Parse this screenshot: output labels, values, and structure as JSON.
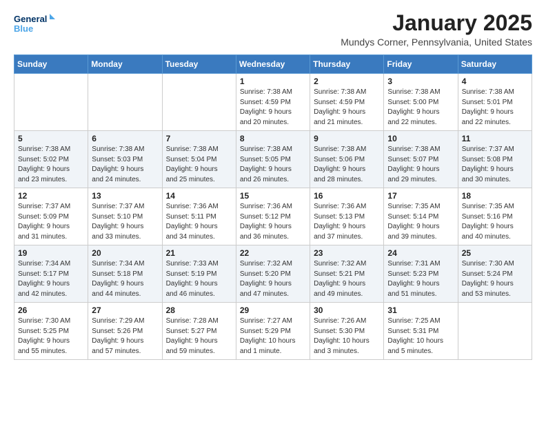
{
  "header": {
    "logo_line1": "General",
    "logo_line2": "Blue",
    "month": "January 2025",
    "location": "Mundys Corner, Pennsylvania, United States"
  },
  "weekdays": [
    "Sunday",
    "Monday",
    "Tuesday",
    "Wednesday",
    "Thursday",
    "Friday",
    "Saturday"
  ],
  "weeks": [
    [
      {
        "day": "",
        "info": ""
      },
      {
        "day": "",
        "info": ""
      },
      {
        "day": "",
        "info": ""
      },
      {
        "day": "1",
        "info": "Sunrise: 7:38 AM\nSunset: 4:59 PM\nDaylight: 9 hours\nand 20 minutes."
      },
      {
        "day": "2",
        "info": "Sunrise: 7:38 AM\nSunset: 4:59 PM\nDaylight: 9 hours\nand 21 minutes."
      },
      {
        "day": "3",
        "info": "Sunrise: 7:38 AM\nSunset: 5:00 PM\nDaylight: 9 hours\nand 22 minutes."
      },
      {
        "day": "4",
        "info": "Sunrise: 7:38 AM\nSunset: 5:01 PM\nDaylight: 9 hours\nand 22 minutes."
      }
    ],
    [
      {
        "day": "5",
        "info": "Sunrise: 7:38 AM\nSunset: 5:02 PM\nDaylight: 9 hours\nand 23 minutes."
      },
      {
        "day": "6",
        "info": "Sunrise: 7:38 AM\nSunset: 5:03 PM\nDaylight: 9 hours\nand 24 minutes."
      },
      {
        "day": "7",
        "info": "Sunrise: 7:38 AM\nSunset: 5:04 PM\nDaylight: 9 hours\nand 25 minutes."
      },
      {
        "day": "8",
        "info": "Sunrise: 7:38 AM\nSunset: 5:05 PM\nDaylight: 9 hours\nand 26 minutes."
      },
      {
        "day": "9",
        "info": "Sunrise: 7:38 AM\nSunset: 5:06 PM\nDaylight: 9 hours\nand 28 minutes."
      },
      {
        "day": "10",
        "info": "Sunrise: 7:38 AM\nSunset: 5:07 PM\nDaylight: 9 hours\nand 29 minutes."
      },
      {
        "day": "11",
        "info": "Sunrise: 7:37 AM\nSunset: 5:08 PM\nDaylight: 9 hours\nand 30 minutes."
      }
    ],
    [
      {
        "day": "12",
        "info": "Sunrise: 7:37 AM\nSunset: 5:09 PM\nDaylight: 9 hours\nand 31 minutes."
      },
      {
        "day": "13",
        "info": "Sunrise: 7:37 AM\nSunset: 5:10 PM\nDaylight: 9 hours\nand 33 minutes."
      },
      {
        "day": "14",
        "info": "Sunrise: 7:36 AM\nSunset: 5:11 PM\nDaylight: 9 hours\nand 34 minutes."
      },
      {
        "day": "15",
        "info": "Sunrise: 7:36 AM\nSunset: 5:12 PM\nDaylight: 9 hours\nand 36 minutes."
      },
      {
        "day": "16",
        "info": "Sunrise: 7:36 AM\nSunset: 5:13 PM\nDaylight: 9 hours\nand 37 minutes."
      },
      {
        "day": "17",
        "info": "Sunrise: 7:35 AM\nSunset: 5:14 PM\nDaylight: 9 hours\nand 39 minutes."
      },
      {
        "day": "18",
        "info": "Sunrise: 7:35 AM\nSunset: 5:16 PM\nDaylight: 9 hours\nand 40 minutes."
      }
    ],
    [
      {
        "day": "19",
        "info": "Sunrise: 7:34 AM\nSunset: 5:17 PM\nDaylight: 9 hours\nand 42 minutes."
      },
      {
        "day": "20",
        "info": "Sunrise: 7:34 AM\nSunset: 5:18 PM\nDaylight: 9 hours\nand 44 minutes."
      },
      {
        "day": "21",
        "info": "Sunrise: 7:33 AM\nSunset: 5:19 PM\nDaylight: 9 hours\nand 46 minutes."
      },
      {
        "day": "22",
        "info": "Sunrise: 7:32 AM\nSunset: 5:20 PM\nDaylight: 9 hours\nand 47 minutes."
      },
      {
        "day": "23",
        "info": "Sunrise: 7:32 AM\nSunset: 5:21 PM\nDaylight: 9 hours\nand 49 minutes."
      },
      {
        "day": "24",
        "info": "Sunrise: 7:31 AM\nSunset: 5:23 PM\nDaylight: 9 hours\nand 51 minutes."
      },
      {
        "day": "25",
        "info": "Sunrise: 7:30 AM\nSunset: 5:24 PM\nDaylight: 9 hours\nand 53 minutes."
      }
    ],
    [
      {
        "day": "26",
        "info": "Sunrise: 7:30 AM\nSunset: 5:25 PM\nDaylight: 9 hours\nand 55 minutes."
      },
      {
        "day": "27",
        "info": "Sunrise: 7:29 AM\nSunset: 5:26 PM\nDaylight: 9 hours\nand 57 minutes."
      },
      {
        "day": "28",
        "info": "Sunrise: 7:28 AM\nSunset: 5:27 PM\nDaylight: 9 hours\nand 59 minutes."
      },
      {
        "day": "29",
        "info": "Sunrise: 7:27 AM\nSunset: 5:29 PM\nDaylight: 10 hours\nand 1 minute."
      },
      {
        "day": "30",
        "info": "Sunrise: 7:26 AM\nSunset: 5:30 PM\nDaylight: 10 hours\nand 3 minutes."
      },
      {
        "day": "31",
        "info": "Sunrise: 7:25 AM\nSunset: 5:31 PM\nDaylight: 10 hours\nand 5 minutes."
      },
      {
        "day": "",
        "info": ""
      }
    ]
  ]
}
